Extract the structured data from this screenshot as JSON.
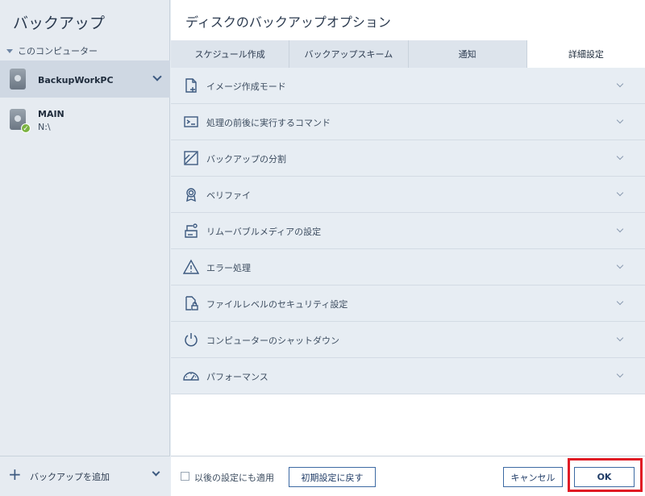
{
  "sidebar": {
    "title": "バックアップ",
    "section": "このコンピューター",
    "items": [
      {
        "name": "BackupWorkPC",
        "sub": ""
      },
      {
        "name": "MAIN",
        "sub": "N:\\"
      }
    ],
    "add_label": "バックアップを追加"
  },
  "main": {
    "title": "ディスクのバックアップオプション",
    "tabs": [
      "スケジュール作成",
      "バックアップスキーム",
      "通知",
      "詳細設定"
    ],
    "options": [
      {
        "label": "イメージ作成モード",
        "icon": "document-plus-icon"
      },
      {
        "label": "処理の前後に実行するコマンド",
        "icon": "terminal-icon"
      },
      {
        "label": "バックアップの分割",
        "icon": "split-icon"
      },
      {
        "label": "ベリファイ",
        "icon": "certificate-icon"
      },
      {
        "label": "リムーバブルメディアの設定",
        "icon": "removable-drive-icon"
      },
      {
        "label": "エラー処理",
        "icon": "warning-icon"
      },
      {
        "label": "ファイルレベルのセキュリティ設定",
        "icon": "file-lock-icon"
      },
      {
        "label": "コンピューターのシャットダウン",
        "icon": "power-icon"
      },
      {
        "label": "パフォーマンス",
        "icon": "gauge-icon"
      }
    ],
    "footer": {
      "apply_label": "以後の設定にも適用",
      "reset_label": "初期設定に戻す",
      "cancel_label": "キャンセル",
      "ok_label": "OK"
    }
  },
  "colors": {
    "accent": "#3d6aa3",
    "highlight": "#e01b24",
    "check": "#7cb342"
  }
}
